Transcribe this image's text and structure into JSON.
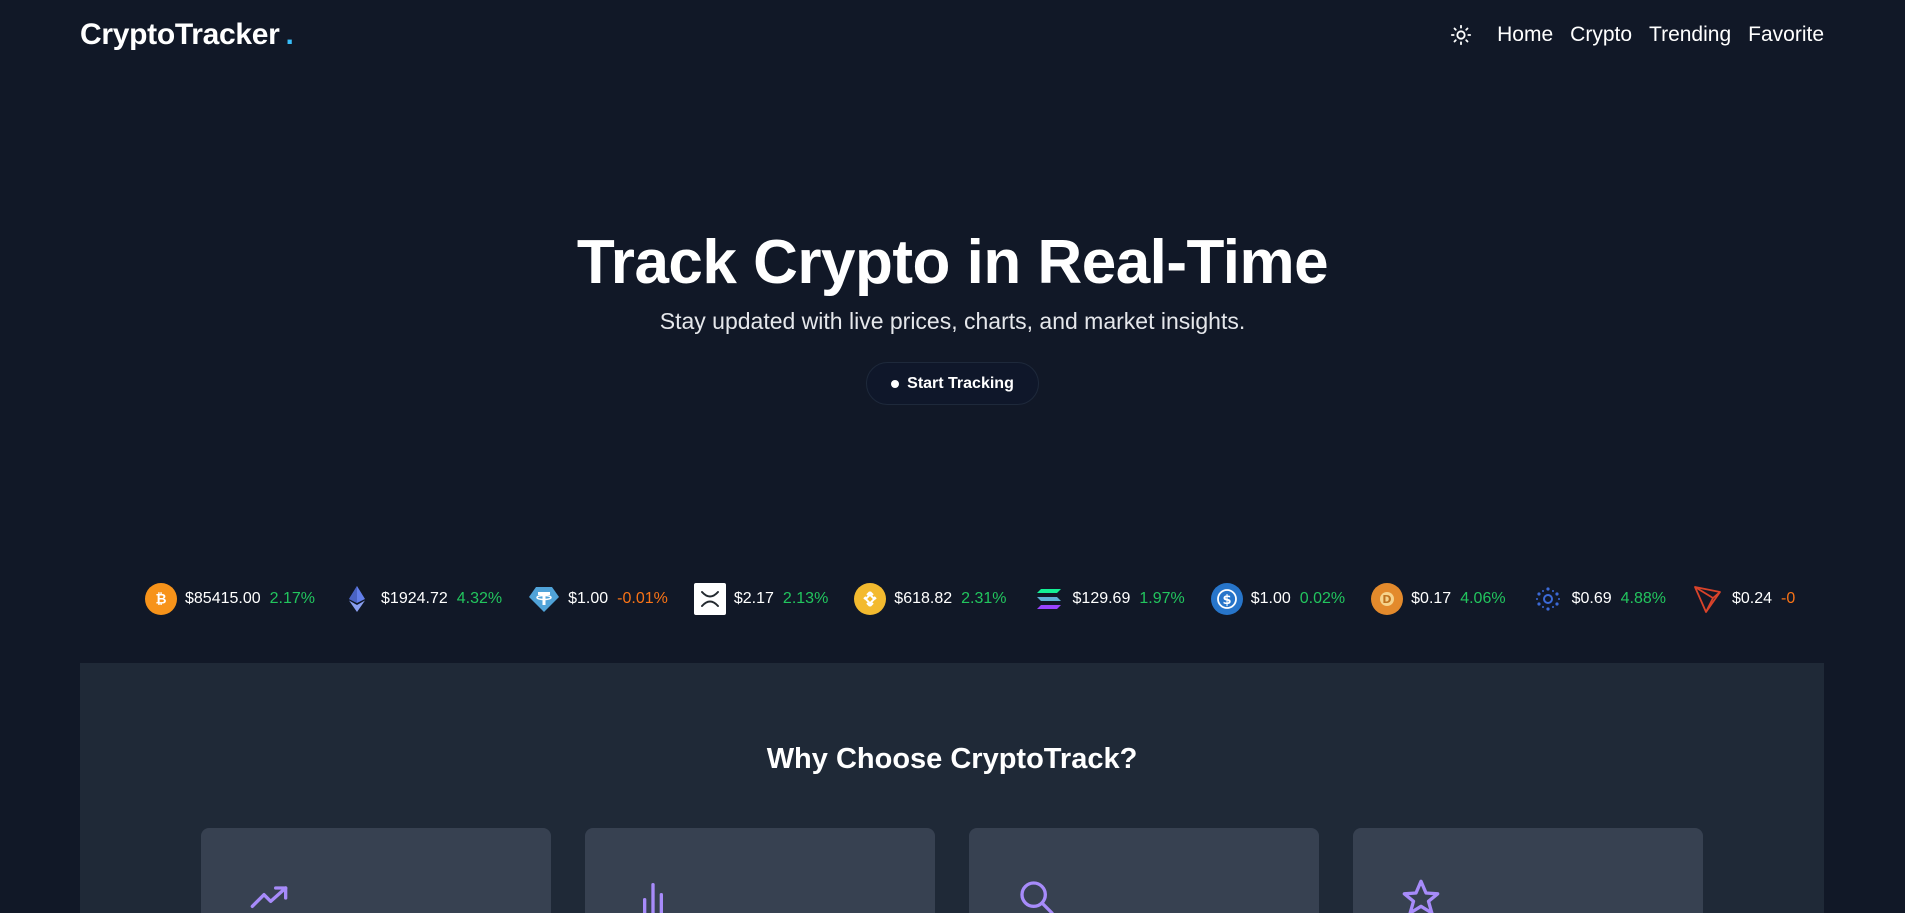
{
  "nav": {
    "logo": "CryptoTracker",
    "logo_dot": ".",
    "theme_icon": "sun-icon",
    "links": [
      "Home",
      "Crypto",
      "Trending",
      "Favorite"
    ]
  },
  "hero": {
    "title": "Track Crypto in Real-Time",
    "subtitle": "Stay updated with live prices, charts, and market insights.",
    "cta_label": "Start Tracking"
  },
  "ticker": [
    {
      "icon": "bitcoin-icon",
      "price": "$85415.00",
      "change": "2.17%",
      "direction": "up"
    },
    {
      "icon": "ethereum-icon",
      "price": "$1924.72",
      "change": "4.32%",
      "direction": "up"
    },
    {
      "icon": "tether-icon",
      "price": "$1.00",
      "change": "-0.01%",
      "direction": "down"
    },
    {
      "icon": "xrp-icon",
      "price": "$2.17",
      "change": "2.13%",
      "direction": "up"
    },
    {
      "icon": "bnb-icon",
      "price": "$618.82",
      "change": "2.31%",
      "direction": "up"
    },
    {
      "icon": "solana-icon",
      "price": "$129.69",
      "change": "1.97%",
      "direction": "up"
    },
    {
      "icon": "usdc-icon",
      "price": "$1.00",
      "change": "0.02%",
      "direction": "up"
    },
    {
      "icon": "dogecoin-icon",
      "price": "$0.17",
      "change": "4.06%",
      "direction": "up"
    },
    {
      "icon": "cardano-icon",
      "price": "$0.69",
      "change": "4.88%",
      "direction": "up"
    },
    {
      "icon": "tron-icon",
      "price": "$0.24",
      "change": "-0",
      "direction": "down"
    }
  ],
  "features": {
    "title": "Why Choose CryptoTrack?",
    "cards": [
      {
        "icon": "trending-up-icon"
      },
      {
        "icon": "bar-chart-icon"
      },
      {
        "icon": "search-icon"
      },
      {
        "icon": "star-icon"
      }
    ]
  },
  "colors": {
    "background": "#111827",
    "section": "#1f2937",
    "card": "#374151",
    "accent": "#38bdf8",
    "icon_purple": "#a78bfa",
    "positive": "#22c55e",
    "negative": "#f97316"
  }
}
